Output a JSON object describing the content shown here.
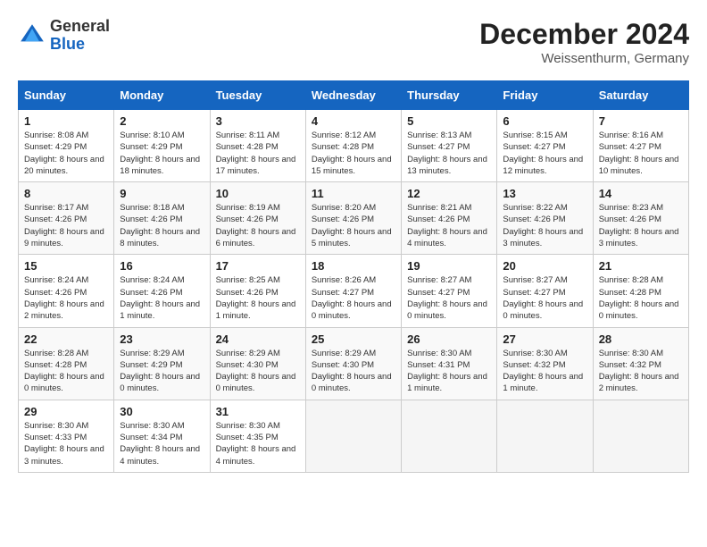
{
  "header": {
    "logo_general": "General",
    "logo_blue": "Blue",
    "month_year": "December 2024",
    "location": "Weissenthurm, Germany"
  },
  "weekdays": [
    "Sunday",
    "Monday",
    "Tuesday",
    "Wednesday",
    "Thursday",
    "Friday",
    "Saturday"
  ],
  "weeks": [
    [
      {
        "day": "1",
        "sunrise": "Sunrise: 8:08 AM",
        "sunset": "Sunset: 4:29 PM",
        "daylight": "Daylight: 8 hours and 20 minutes."
      },
      {
        "day": "2",
        "sunrise": "Sunrise: 8:10 AM",
        "sunset": "Sunset: 4:29 PM",
        "daylight": "Daylight: 8 hours and 18 minutes."
      },
      {
        "day": "3",
        "sunrise": "Sunrise: 8:11 AM",
        "sunset": "Sunset: 4:28 PM",
        "daylight": "Daylight: 8 hours and 17 minutes."
      },
      {
        "day": "4",
        "sunrise": "Sunrise: 8:12 AM",
        "sunset": "Sunset: 4:28 PM",
        "daylight": "Daylight: 8 hours and 15 minutes."
      },
      {
        "day": "5",
        "sunrise": "Sunrise: 8:13 AM",
        "sunset": "Sunset: 4:27 PM",
        "daylight": "Daylight: 8 hours and 13 minutes."
      },
      {
        "day": "6",
        "sunrise": "Sunrise: 8:15 AM",
        "sunset": "Sunset: 4:27 PM",
        "daylight": "Daylight: 8 hours and 12 minutes."
      },
      {
        "day": "7",
        "sunrise": "Sunrise: 8:16 AM",
        "sunset": "Sunset: 4:27 PM",
        "daylight": "Daylight: 8 hours and 10 minutes."
      }
    ],
    [
      {
        "day": "8",
        "sunrise": "Sunrise: 8:17 AM",
        "sunset": "Sunset: 4:26 PM",
        "daylight": "Daylight: 8 hours and 9 minutes."
      },
      {
        "day": "9",
        "sunrise": "Sunrise: 8:18 AM",
        "sunset": "Sunset: 4:26 PM",
        "daylight": "Daylight: 8 hours and 8 minutes."
      },
      {
        "day": "10",
        "sunrise": "Sunrise: 8:19 AM",
        "sunset": "Sunset: 4:26 PM",
        "daylight": "Daylight: 8 hours and 6 minutes."
      },
      {
        "day": "11",
        "sunrise": "Sunrise: 8:20 AM",
        "sunset": "Sunset: 4:26 PM",
        "daylight": "Daylight: 8 hours and 5 minutes."
      },
      {
        "day": "12",
        "sunrise": "Sunrise: 8:21 AM",
        "sunset": "Sunset: 4:26 PM",
        "daylight": "Daylight: 8 hours and 4 minutes."
      },
      {
        "day": "13",
        "sunrise": "Sunrise: 8:22 AM",
        "sunset": "Sunset: 4:26 PM",
        "daylight": "Daylight: 8 hours and 3 minutes."
      },
      {
        "day": "14",
        "sunrise": "Sunrise: 8:23 AM",
        "sunset": "Sunset: 4:26 PM",
        "daylight": "Daylight: 8 hours and 3 minutes."
      }
    ],
    [
      {
        "day": "15",
        "sunrise": "Sunrise: 8:24 AM",
        "sunset": "Sunset: 4:26 PM",
        "daylight": "Daylight: 8 hours and 2 minutes."
      },
      {
        "day": "16",
        "sunrise": "Sunrise: 8:24 AM",
        "sunset": "Sunset: 4:26 PM",
        "daylight": "Daylight: 8 hours and 1 minute."
      },
      {
        "day": "17",
        "sunrise": "Sunrise: 8:25 AM",
        "sunset": "Sunset: 4:26 PM",
        "daylight": "Daylight: 8 hours and 1 minute."
      },
      {
        "day": "18",
        "sunrise": "Sunrise: 8:26 AM",
        "sunset": "Sunset: 4:27 PM",
        "daylight": "Daylight: 8 hours and 0 minutes."
      },
      {
        "day": "19",
        "sunrise": "Sunrise: 8:27 AM",
        "sunset": "Sunset: 4:27 PM",
        "daylight": "Daylight: 8 hours and 0 minutes."
      },
      {
        "day": "20",
        "sunrise": "Sunrise: 8:27 AM",
        "sunset": "Sunset: 4:27 PM",
        "daylight": "Daylight: 8 hours and 0 minutes."
      },
      {
        "day": "21",
        "sunrise": "Sunrise: 8:28 AM",
        "sunset": "Sunset: 4:28 PM",
        "daylight": "Daylight: 8 hours and 0 minutes."
      }
    ],
    [
      {
        "day": "22",
        "sunrise": "Sunrise: 8:28 AM",
        "sunset": "Sunset: 4:28 PM",
        "daylight": "Daylight: 8 hours and 0 minutes."
      },
      {
        "day": "23",
        "sunrise": "Sunrise: 8:29 AM",
        "sunset": "Sunset: 4:29 PM",
        "daylight": "Daylight: 8 hours and 0 minutes."
      },
      {
        "day": "24",
        "sunrise": "Sunrise: 8:29 AM",
        "sunset": "Sunset: 4:30 PM",
        "daylight": "Daylight: 8 hours and 0 minutes."
      },
      {
        "day": "25",
        "sunrise": "Sunrise: 8:29 AM",
        "sunset": "Sunset: 4:30 PM",
        "daylight": "Daylight: 8 hours and 0 minutes."
      },
      {
        "day": "26",
        "sunrise": "Sunrise: 8:30 AM",
        "sunset": "Sunset: 4:31 PM",
        "daylight": "Daylight: 8 hours and 1 minute."
      },
      {
        "day": "27",
        "sunrise": "Sunrise: 8:30 AM",
        "sunset": "Sunset: 4:32 PM",
        "daylight": "Daylight: 8 hours and 1 minute."
      },
      {
        "day": "28",
        "sunrise": "Sunrise: 8:30 AM",
        "sunset": "Sunset: 4:32 PM",
        "daylight": "Daylight: 8 hours and 2 minutes."
      }
    ],
    [
      {
        "day": "29",
        "sunrise": "Sunrise: 8:30 AM",
        "sunset": "Sunset: 4:33 PM",
        "daylight": "Daylight: 8 hours and 3 minutes."
      },
      {
        "day": "30",
        "sunrise": "Sunrise: 8:30 AM",
        "sunset": "Sunset: 4:34 PM",
        "daylight": "Daylight: 8 hours and 4 minutes."
      },
      {
        "day": "31",
        "sunrise": "Sunrise: 8:30 AM",
        "sunset": "Sunset: 4:35 PM",
        "daylight": "Daylight: 8 hours and 4 minutes."
      },
      null,
      null,
      null,
      null
    ]
  ]
}
